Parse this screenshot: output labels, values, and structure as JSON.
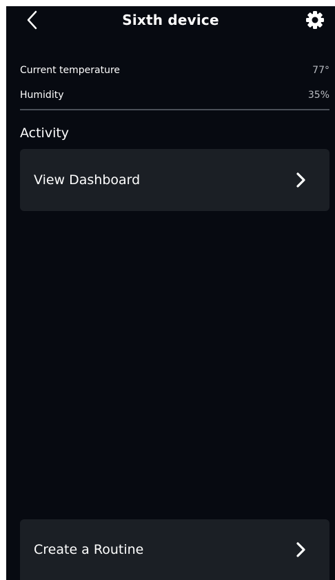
{
  "header": {
    "title": "Sixth device",
    "back_icon": "chevron-left-icon",
    "settings_icon": "gear-icon"
  },
  "stats": {
    "temperature": {
      "label": "Current temperature",
      "value": "77°"
    },
    "humidity": {
      "label": "Humidity",
      "value": "35%"
    }
  },
  "activity": {
    "title": "Activity",
    "dashboard_label": "View Dashboard"
  },
  "routine": {
    "label": "Create a Routine"
  },
  "colors": {
    "background": "#070a11",
    "card": "#1b1f25",
    "text": "#ffffff",
    "muted": "#b9bcc2"
  }
}
